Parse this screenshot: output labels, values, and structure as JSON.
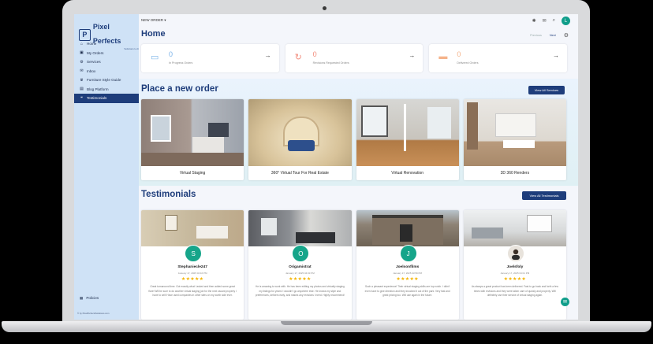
{
  "brand": {
    "name": "Pixel Perfects",
    "tagline": "Solutions LLC"
  },
  "sidebar": {
    "items": [
      {
        "label": "Home",
        "icon": "home-icon"
      },
      {
        "label": "My Orders",
        "icon": "orders-icon"
      },
      {
        "label": "Services",
        "icon": "services-icon"
      },
      {
        "label": "Inbox",
        "icon": "inbox-icon"
      },
      {
        "label": "Furniture Style Guide",
        "icon": "trophy-icon"
      },
      {
        "label": "Blog Platform",
        "icon": "blog-icon"
      },
      {
        "label": "Testimonials",
        "icon": "testimonials-icon"
      }
    ],
    "active_index": 6,
    "policies_label": "Policies",
    "footer_note": "© by PixelPerfectsSolutions.com"
  },
  "topbar": {
    "breadcrumb": "NEW ORDER"
  },
  "page": {
    "title": "Home",
    "prev_label": "Previous",
    "next_label": "Next"
  },
  "stats": [
    {
      "value": "0",
      "label": "In Progress Orders",
      "icon": "briefcase-icon",
      "color": "#7ab3e8"
    },
    {
      "value": "0",
      "label": "Revisions Requested Orders",
      "icon": "refresh-icon",
      "color": "#f28c7c"
    },
    {
      "value": "0",
      "label": "Delivered Orders",
      "icon": "truck-icon",
      "color": "#f5b38a"
    }
  ],
  "order_section": {
    "title": "Place a new order",
    "view_all_label": "View All Services",
    "services": [
      {
        "label": "Virtual Staging"
      },
      {
        "label": "360° Virtual Tour For Real Estate"
      },
      {
        "label": "Virtual Renovation"
      },
      {
        "label": "3D 360 Renders"
      }
    ]
  },
  "testimonials_section": {
    "title": "Testimonials",
    "view_all_label": "View All Testimonials",
    "items": [
      {
        "initial": "S",
        "name": "Stephaniecle247",
        "date": "January 17, 2025 04:16 PM",
        "stars": 5,
        "text": "Great turnaround time. Got exactly what I asked and then added some great flare! Will be sure to do another virtual staging job for the next vacant property I have to sell! Have used companies in other sites on my worth side ever."
      },
      {
        "initial": "O",
        "name": "Origamistrat",
        "date": "January 17, 2025 04:03 PM",
        "stars": 5,
        "text": "He is amazing to work with. He has been editing my photos and virtually staging my listings for years! I wouldn't go anywhere else. He knows my style and preferences, delivers early, and makes any revisions I need. Highly recommend!"
      },
      {
        "initial": "J",
        "name": "Joelsonfilms",
        "date": "January 17, 2025 03:59 PM",
        "stars": 5,
        "text": "Such a pleasant experience! Their virtual staging skills are top notch. I didn't even have to give direction and they knocked it out of the park. Very fast and great pricing too. Will use again in the future."
      },
      {
        "initial": "",
        "name": "Joelsfoly",
        "date": "January 17, 2025 04:01 PM",
        "stars": 5,
        "text": "As always a great product has been delivered. Fast to go back and forth a few times with revisions and they were taken care of quickly and properly. Will definitely use their service of virtual staging again."
      }
    ]
  },
  "colors": {
    "brand": "#1e3d7b",
    "accent": "#0f9d8a",
    "star": "#f5b400",
    "sidebar_bg": "#cfe2f6"
  }
}
